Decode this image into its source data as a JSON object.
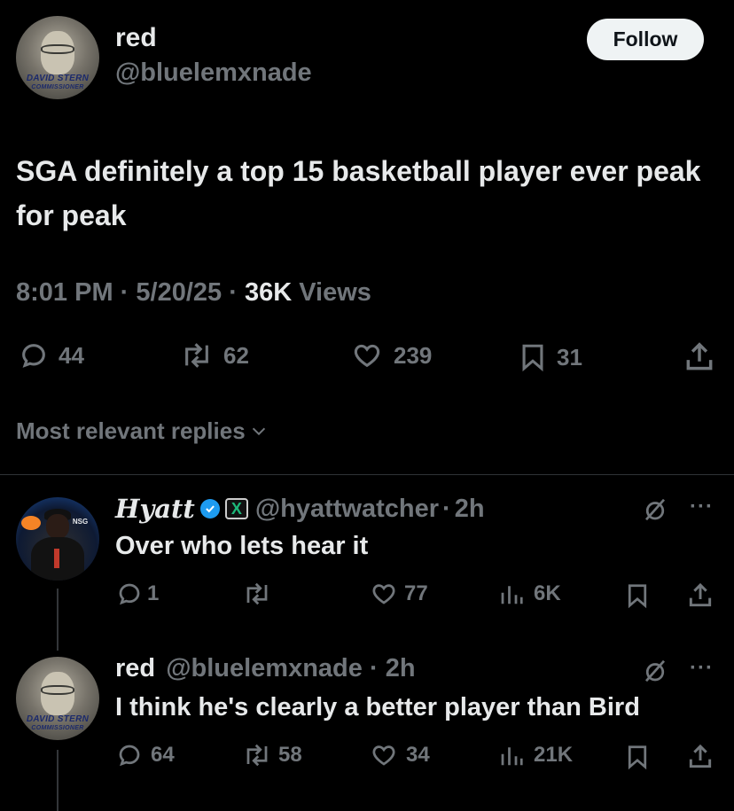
{
  "tweet": {
    "author_name": "red",
    "author_handle": "@bluelemxnade",
    "avatar_banner": "DAVID STERN",
    "avatar_banner_sub": "COMMISSIONER",
    "follow_label": "Follow",
    "text": "SGA definitely a top 15 basketball player ever peak for peak",
    "time": "8:01 PM",
    "sep1": "·",
    "date": "5/20/25",
    "sep2": "·",
    "views_count": "36K",
    "views_label": "Views",
    "actions": {
      "replies": "44",
      "reposts": "62",
      "likes": "239",
      "bookmarks": "31"
    }
  },
  "replies_sort": {
    "label": "Most relevant replies",
    "icon": "chevron-down-icon"
  },
  "replies": [
    {
      "author_name": "Hyatt",
      "verified": true,
      "badge_x": "X",
      "author_handle": "@hyattwatcher",
      "sep": "·",
      "age": "2h",
      "text": "Over who lets hear it",
      "avatar_text": "NSG",
      "actions": {
        "replies": "1",
        "reposts": "",
        "likes": "77",
        "views": "6K"
      }
    },
    {
      "author_name": "red",
      "author_handle": "@bluelemxnade",
      "sep": "·",
      "age": "2h",
      "text": "I think he's clearly a better player than Bird",
      "avatar_banner": "DAVID STERN",
      "avatar_banner_sub": "COMMISSIONER",
      "actions": {
        "replies": "64",
        "reposts": "58",
        "likes": "34",
        "views": "21K"
      }
    }
  ],
  "colors": {
    "background": "#000000",
    "text": "#e7e9ea",
    "muted": "#71767b",
    "verified": "#1d9bf0",
    "divider": "#2f3336"
  }
}
